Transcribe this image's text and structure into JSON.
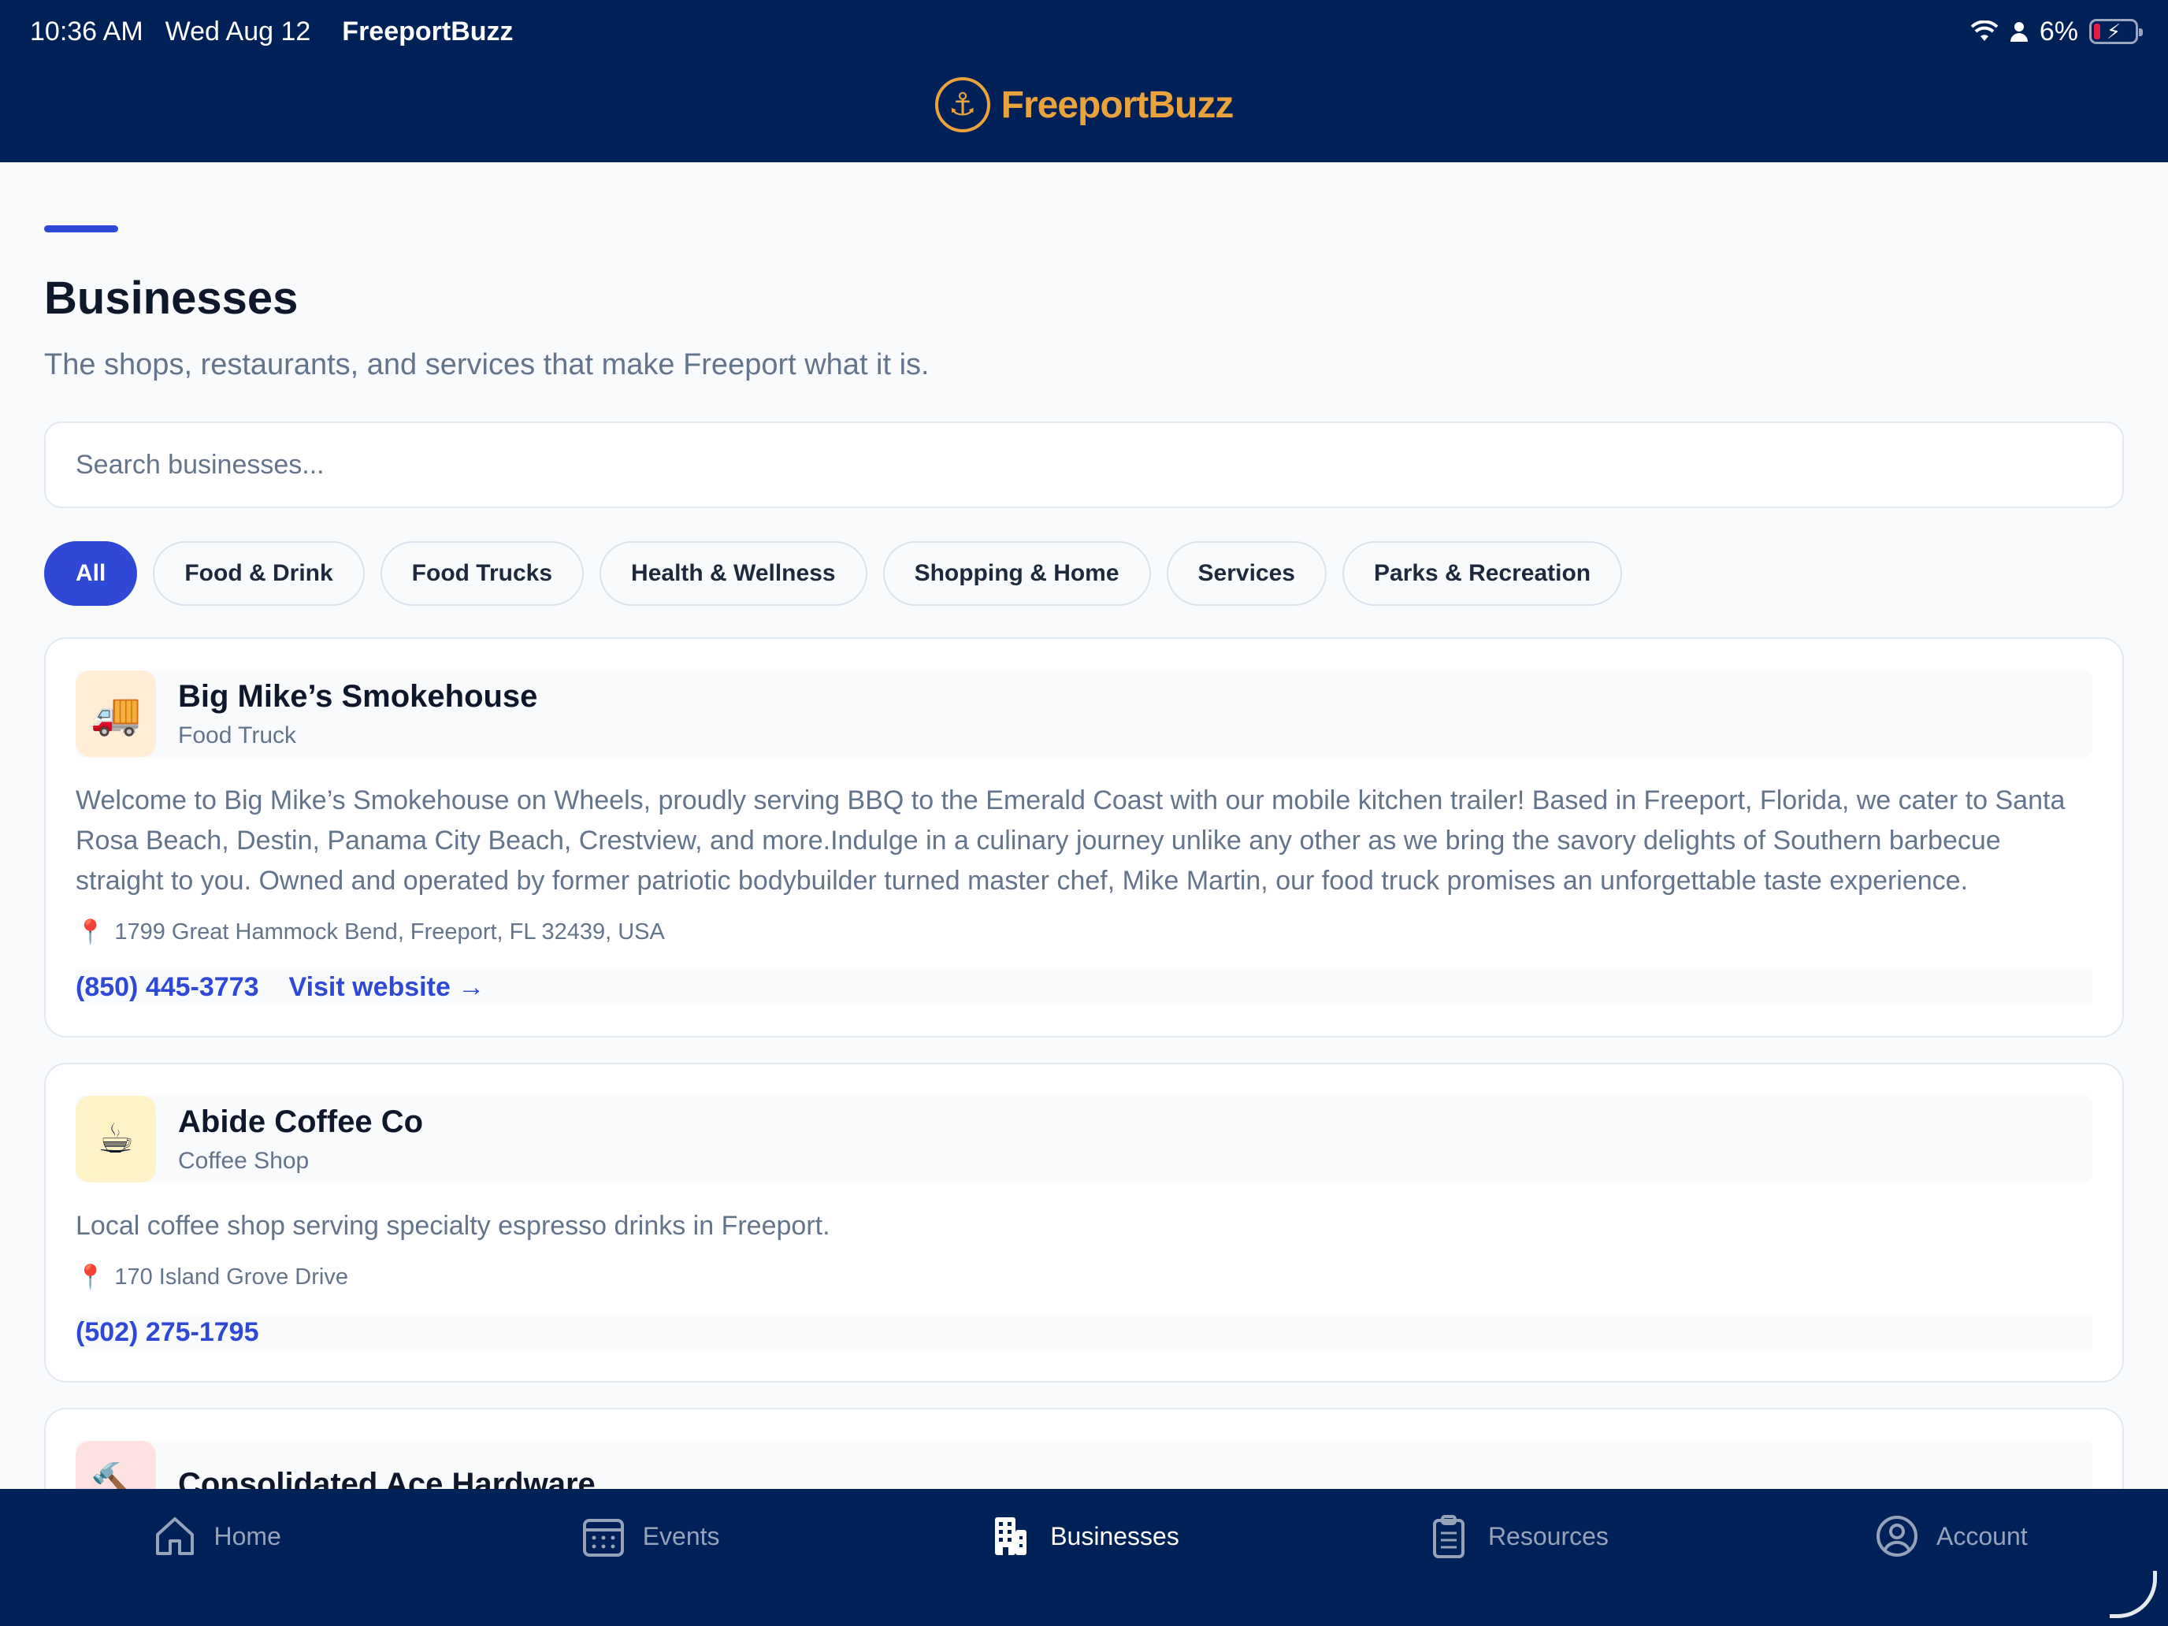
{
  "status_bar": {
    "time": "10:36 AM",
    "date": "Wed Aug 12",
    "app": "FreeportBuzz",
    "battery": "6%"
  },
  "header": {
    "logo_text": "FreeportBuzz"
  },
  "page": {
    "title": "Businesses",
    "subtitle": "The shops, restaurants, and services that make Freeport what it is."
  },
  "search": {
    "placeholder": "Search businesses..."
  },
  "filters": [
    "All",
    "Food & Drink",
    "Food Trucks",
    "Health & Wellness",
    "Shopping & Home",
    "Services",
    "Parks & Recreation"
  ],
  "businesses": [
    {
      "name": "Big Mike’s Smokehouse",
      "category": "Food Truck",
      "emoji": "🚚",
      "description": "Welcome to Big Mike’s Smokehouse on Wheels, proudly serving BBQ to the Emerald Coast with our mobile kitchen trailer! Based in Freeport, Florida, we cater to Santa Rosa Beach, Destin, Panama City Beach, Crestview, and more.Indulge in a culinary journey unlike any other as we bring the savory delights of Southern barbecue straight to you. Owned and operated by former patriotic bodybuilder turned master chef, Mike Martin, our food truck promises an unforgettable taste experience.",
      "address": "1799 Great Hammock Bend, Freeport, FL 32439, USA",
      "phone": "(850) 445-3773",
      "website_label": "Visit website →"
    },
    {
      "name": "Abide Coffee Co",
      "category": "Coffee Shop",
      "emoji": "☕",
      "description": "Local coffee shop serving specialty espresso drinks in Freeport.",
      "address": "170 Island Grove Drive",
      "phone": "(502) 275-1795"
    },
    {
      "name": "Consolidated Ace Hardware",
      "emoji": "🔨"
    }
  ],
  "tabs": [
    {
      "label": "Home",
      "icon": "home-icon"
    },
    {
      "label": "Events",
      "icon": "calendar-icon"
    },
    {
      "label": "Businesses",
      "icon": "building-icon",
      "active": true
    },
    {
      "label": "Resources",
      "icon": "clipboard-icon"
    },
    {
      "label": "Account",
      "icon": "account-icon"
    }
  ],
  "colors": {
    "navy": "#002058",
    "accent": "#2f49d6",
    "gold": "#e8a33d"
  }
}
